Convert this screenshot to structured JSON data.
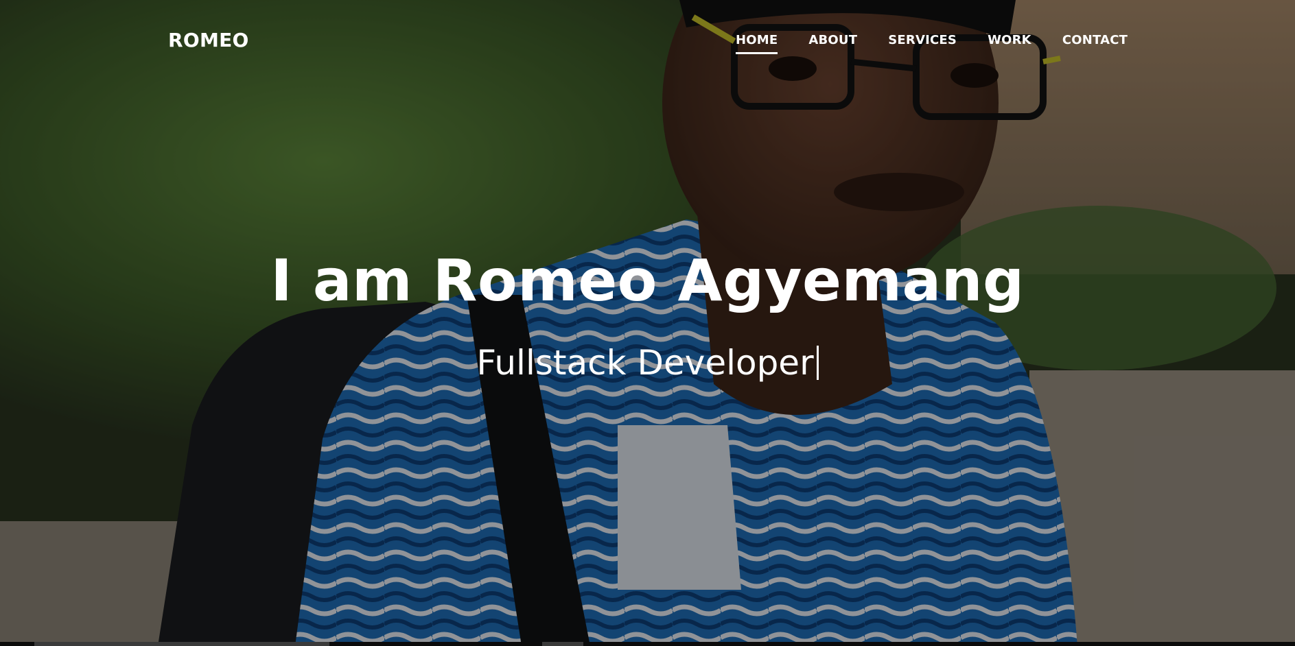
{
  "brand": "ROMEO",
  "nav": {
    "items": [
      {
        "label": "HOME",
        "active": true
      },
      {
        "label": "ABOUT",
        "active": false
      },
      {
        "label": "SERVICES",
        "active": false
      },
      {
        "label": "WORK",
        "active": false
      },
      {
        "label": "CONTACT",
        "active": false
      }
    ]
  },
  "hero": {
    "headline": "I am Romeo Agyemang",
    "subline": "Fullstack Developer"
  },
  "colors": {
    "text": "#ffffff",
    "overlay": "rgba(0,0,0,0.38)"
  }
}
